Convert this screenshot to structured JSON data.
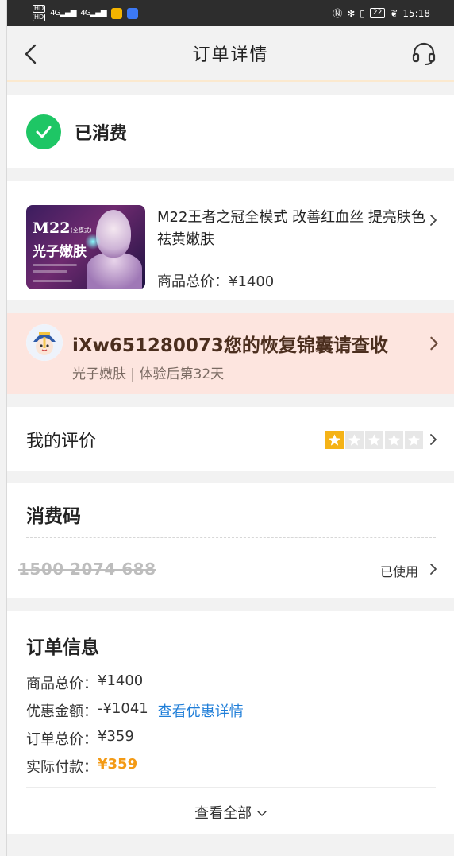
{
  "status_bar": {
    "hd1": "HD",
    "hd2": "HD",
    "signal1": "4G",
    "signal2": "4G",
    "battery": "22",
    "time": "15:18"
  },
  "nav": {
    "title": "订单详情",
    "back_icon": "chevron-left-icon",
    "service_icon": "headset-icon"
  },
  "status": {
    "label": "已消费",
    "icon": "check-circle-icon",
    "color": "#1ec665"
  },
  "product": {
    "thumb_title": "M22",
    "thumb_tag": "(全模式)",
    "thumb_subtitle": "光子嫩肤",
    "name": "M22王者之冠全模式 改善红血丝 提亮肤色 祛黄嫩肤",
    "price_label": "商品总价：",
    "price_value": "¥1400"
  },
  "promo": {
    "title": "iXw651280073您的恢复锦囊请查收",
    "subtitle": "光子嫩肤 | 体验后第32天",
    "background": "#fde5df"
  },
  "rating": {
    "label": "我的评价",
    "stars_filled": 1,
    "stars_total": 5,
    "star_color": "#f5b317"
  },
  "code": {
    "title": "消费码",
    "value": "1500 2074 688",
    "status": "已使用"
  },
  "order_info": {
    "title": "订单信息",
    "lines": [
      {
        "label": "商品总价：",
        "value": "¥1400"
      },
      {
        "label": "优惠金额：",
        "value": "-¥1041",
        "link": "查看优惠详情"
      },
      {
        "label": "订单总价：",
        "value": "¥359"
      },
      {
        "label": "实际付款：",
        "value": "¥359"
      }
    ],
    "view_all": "查看全部",
    "accent": "#f39a15",
    "link_color": "#1f7ed8"
  }
}
